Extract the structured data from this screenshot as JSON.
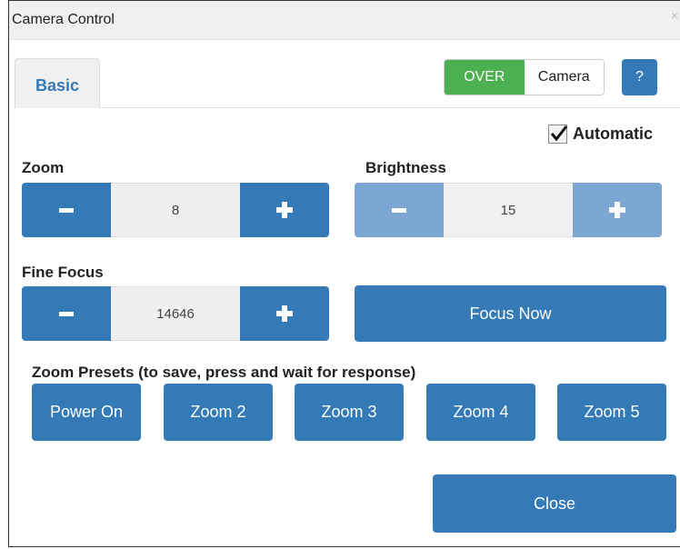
{
  "window": {
    "title": "Camera Control",
    "close_glyph": "×"
  },
  "tabs": [
    {
      "label": "Basic",
      "active": true
    }
  ],
  "mode_toggle": {
    "options": [
      "OVER",
      "Camera"
    ],
    "selected": "OVER"
  },
  "help_button": {
    "label": "?"
  },
  "automatic": {
    "label": "Automatic",
    "checked": true
  },
  "zoom": {
    "label": "Zoom",
    "value": "8"
  },
  "brightness": {
    "label": "Brightness",
    "value": "15",
    "disabled": true
  },
  "fine_focus": {
    "label": "Fine Focus",
    "value": "14646"
  },
  "focus_now": {
    "label": "Focus Now"
  },
  "presets": {
    "label": "Zoom Presets (to save, press and wait for response)",
    "buttons": [
      "Power On",
      "Zoom 2",
      "Zoom 3",
      "Zoom 4",
      "Zoom 5"
    ]
  },
  "close_button": {
    "label": "Close"
  },
  "colors": {
    "primary": "#337ab7",
    "primary_disabled": "#7da7d3",
    "toggle_on": "#4cb050"
  },
  "icons": {
    "minus": "minus-icon",
    "plus": "plus-icon",
    "checkmark": "checkmark-icon",
    "close": "close-icon"
  }
}
